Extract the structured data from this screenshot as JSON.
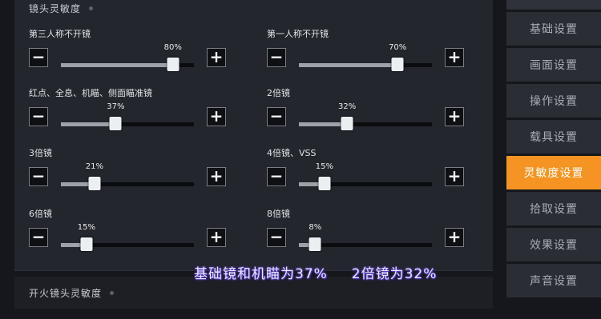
{
  "lens_section": {
    "title": "镜头灵敏度"
  },
  "fire_section": {
    "title": "开火镜头灵敏度"
  },
  "settings": [
    {
      "label": "第三人称不开镜",
      "value": 80,
      "value_text": "80%"
    },
    {
      "label": "第一人称不开镜",
      "value": 70,
      "value_text": "70%"
    },
    {
      "label": "红点、全息、机瞄、侧面瞄准镜",
      "value": 37,
      "value_text": "37%"
    },
    {
      "label": "2倍镜",
      "value": 32,
      "value_text": "32%"
    },
    {
      "label": "3倍镜",
      "value": 21,
      "value_text": "21%"
    },
    {
      "label": "4倍镜、VSS",
      "value": 15,
      "value_text": "15%"
    },
    {
      "label": "6倍镜",
      "value": 15,
      "value_text": "15%"
    },
    {
      "label": "8倍镜",
      "value": 8,
      "value_text": "8%"
    }
  ],
  "stepper": {
    "minus": "−",
    "plus": "+"
  },
  "sidebar": {
    "items": [
      {
        "label": "基础设置",
        "active": false
      },
      {
        "label": "画面设置",
        "active": false
      },
      {
        "label": "操作设置",
        "active": false
      },
      {
        "label": "载具设置",
        "active": false
      },
      {
        "label": "灵敏度设置",
        "active": true
      },
      {
        "label": "拾取设置",
        "active": false
      },
      {
        "label": "效果设置",
        "active": false
      },
      {
        "label": "声音设置",
        "active": false
      }
    ]
  },
  "caption": {
    "left": "基础镜和机瞄为37%",
    "right": "2倍镜为32%"
  },
  "colors": {
    "accent": "#f59422",
    "panel": "#23262d",
    "caption_glow": "#5a3fc2"
  }
}
